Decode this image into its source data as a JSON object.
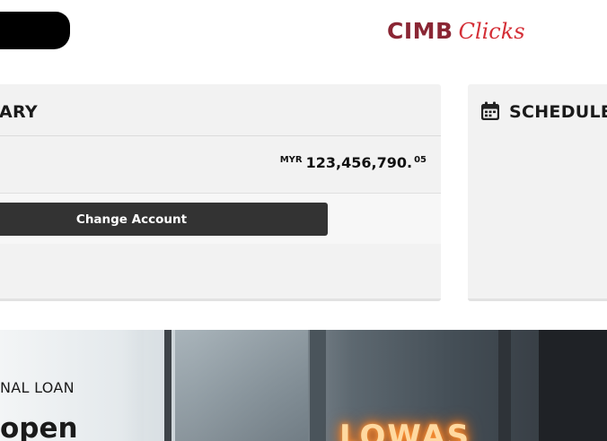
{
  "header": {
    "logo_brand": "CIMB",
    "logo_product": "Clicks"
  },
  "summary": {
    "title": "ARY",
    "balance_currency": "MYR",
    "balance_amount": "123,456,790.",
    "balance_cents": "05",
    "change_account_label": "Change Account"
  },
  "scheduled": {
    "icon": "calendar-icon",
    "title": "SCHEDULE"
  },
  "banner": {
    "label": "NAL LOAN",
    "headline": "open",
    "neon_text": "LOWAS"
  },
  "colors": {
    "brand_dark": "#8a2634",
    "brand_red": "#d42e36",
    "button_bg": "#333333",
    "card_bg": "#f2f2f2"
  }
}
